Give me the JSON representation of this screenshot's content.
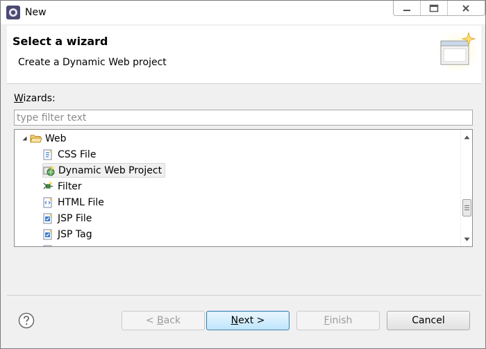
{
  "window": {
    "title": "New"
  },
  "header": {
    "title": "Select a wizard",
    "description": "Create a Dynamic Web project"
  },
  "wizards": {
    "label_accel": "W",
    "label_rest": "izards:",
    "filter_placeholder": "type filter text",
    "tree": {
      "folder": "Web",
      "items": [
        {
          "label": "CSS File",
          "icon": "css-file-icon"
        },
        {
          "label": "Dynamic Web Project",
          "icon": "dynamic-web-project-icon",
          "selected": true
        },
        {
          "label": "Filter",
          "icon": "filter-icon"
        },
        {
          "label": "HTML File",
          "icon": "html-file-icon"
        },
        {
          "label": "JSP File",
          "icon": "jsp-file-icon"
        },
        {
          "label": "JSP Tag",
          "icon": "jsp-tag-icon"
        }
      ]
    }
  },
  "buttons": {
    "back_prefix": "< ",
    "back_accel": "B",
    "back_rest": "ack",
    "next_accel": "N",
    "next_rest": "ext >",
    "finish_accel": "F",
    "finish_rest": "inish",
    "cancel": "Cancel"
  },
  "colors": {
    "accent": "#3c7fb1",
    "folder": "#e8c35a"
  }
}
